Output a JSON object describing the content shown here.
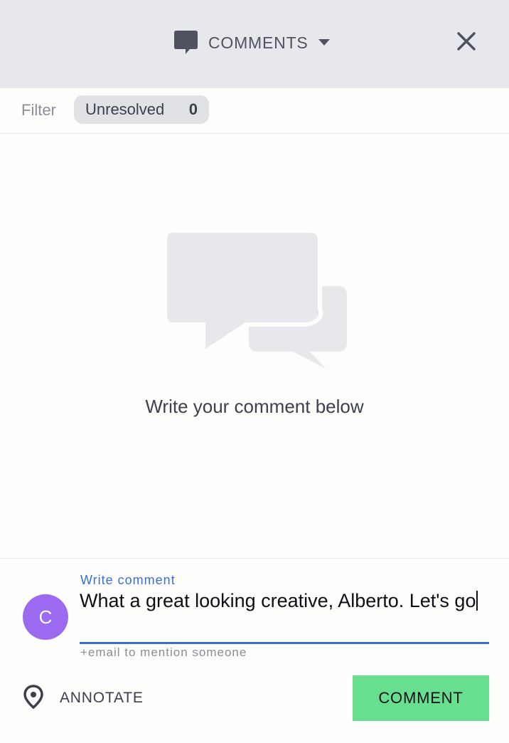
{
  "header": {
    "title": "COMMENTS",
    "icons": {
      "comment": "comment-icon",
      "caret": "caret-down-icon",
      "close": "close-icon"
    }
  },
  "filter": {
    "label": "Filter",
    "chip_label": "Unresolved",
    "chip_count": "0"
  },
  "empty_state": {
    "message": "Write your comment below",
    "icon": "chat-bubbles-icon"
  },
  "composer": {
    "avatar_initial": "C",
    "field_label": "Write comment",
    "value": "What a great looking creative, Alberto. Let's go",
    "helper": "+email to mention someone",
    "annotate_label": "ANNOTATE",
    "annotate_icon": "location-pin-icon",
    "submit_label": "COMMENT"
  },
  "colors": {
    "header_bg": "#e7e8ec",
    "accent": "#3a6fd9",
    "avatar": "#9b6af1",
    "submit": "#67df8e"
  }
}
